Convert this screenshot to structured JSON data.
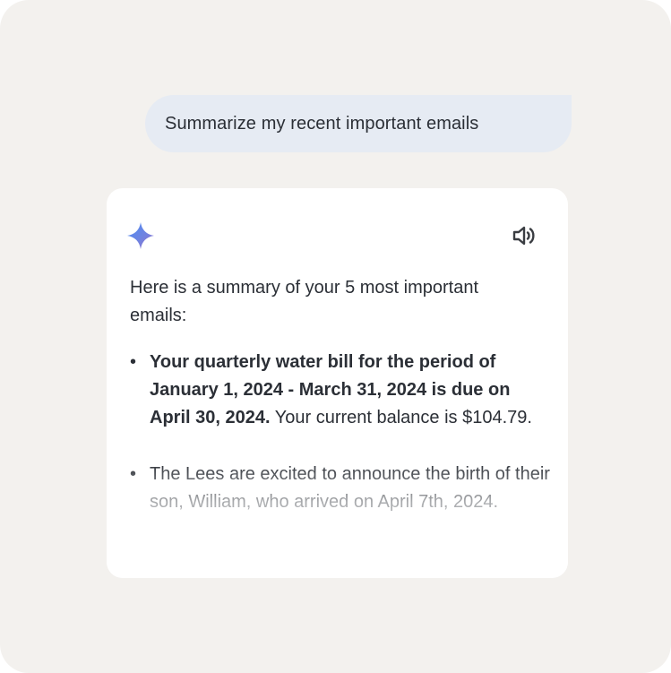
{
  "conversation": {
    "user_prompt": "Summarize my recent important emails",
    "response": {
      "sparkle_icon": "gemini-sparkle-icon",
      "speaker_icon": "speaker-icon",
      "intro": "Here is a summary of your 5 most important emails:",
      "items": [
        {
          "bold": "Your quarterly water bill for the period of January 1, 2024 - March 31, 2024 is due on April 30, 2024.",
          "text": " Your current balance is $104.79."
        },
        {
          "bold": "",
          "text": "The Lees are excited to announce the birth of their son, William, who arrived on April 7th, 2024."
        }
      ]
    }
  },
  "colors": {
    "background": "#f3f1ee",
    "user_bubble": "#e6ebf3",
    "card": "#ffffff",
    "text": "#2b2f36",
    "sparkle_blue": "#4c8df6",
    "sparkle_purple": "#9b72cb"
  }
}
